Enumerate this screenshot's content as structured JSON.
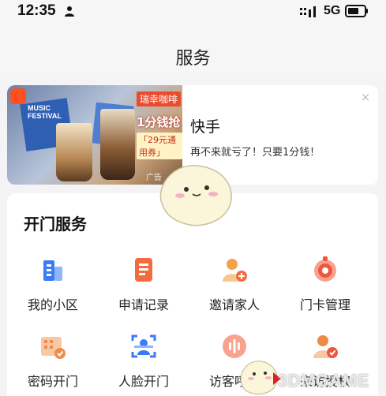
{
  "status_bar": {
    "time": "12:35",
    "network": "5G"
  },
  "header": {
    "title": "服务"
  },
  "ad": {
    "brand": "瑞幸咖啡",
    "festival": "MUSIC FESTIVAL",
    "promo": "1分钱抢",
    "coupon": "「29元通用券」",
    "tag": "广告",
    "title": "快手",
    "description": "再不来就亏了！只要1分钱！",
    "close": "×"
  },
  "section": {
    "title": "开门服务",
    "items": [
      {
        "label": "我的小区",
        "icon": "building-icon",
        "color": "#3a7bf6"
      },
      {
        "label": "申请记录",
        "icon": "document-icon",
        "color": "#f26a3d"
      },
      {
        "label": "邀请家人",
        "icon": "add-person-icon",
        "color": "#f5a14a"
      },
      {
        "label": "门卡管理",
        "icon": "card-icon",
        "color": "#f0553d"
      },
      {
        "label": "密码开门",
        "icon": "password-icon",
        "color": "#f08a4b"
      },
      {
        "label": "人脸开门",
        "icon": "face-scan-icon",
        "color": "#3a7bf6"
      },
      {
        "label": "访客呼叫",
        "icon": "voice-call-icon",
        "color": "#f26a3d"
      },
      {
        "label": "来访授权",
        "icon": "visitor-auth-icon",
        "color": "#f08a4b"
      }
    ]
  },
  "watermark": "3DMGAME"
}
